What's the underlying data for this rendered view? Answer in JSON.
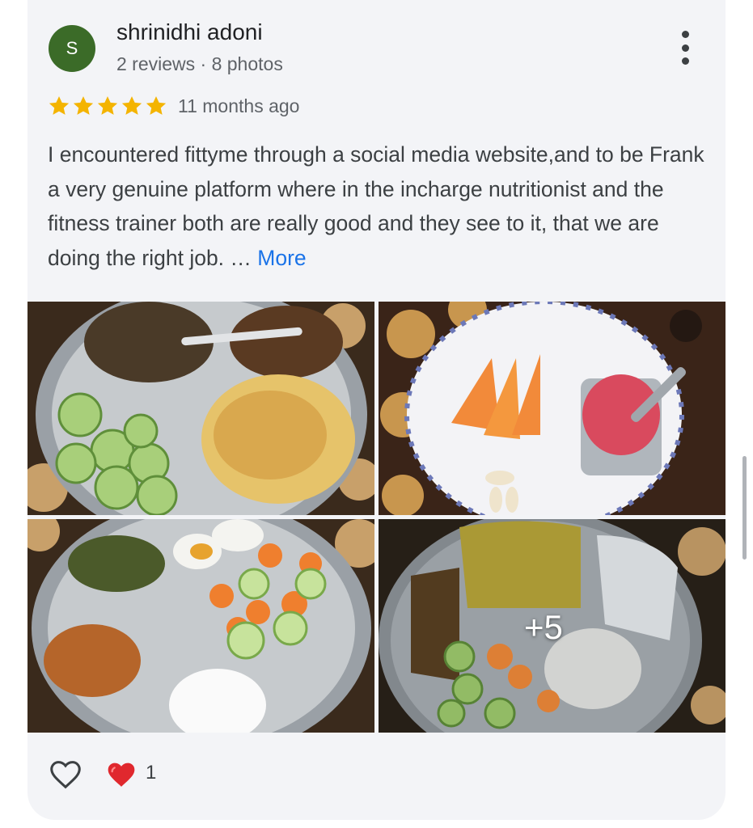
{
  "review": {
    "avatar_letter": "S",
    "author_name": "shrinidhi adoni",
    "author_meta": "2 reviews · 8 photos",
    "rating": 5,
    "rating_max": 5,
    "time_ago": "11 months ago",
    "text": "I encountered fittyme through a social media website,and to be Frank a very genuine platform where in the incharge nutritionist and the fitness trainer both are really good and they see to it, that we are doing the right job. … ",
    "more_label": "More",
    "extra_photos_label": "+5",
    "reaction_count": "1"
  },
  "icons": {
    "menu": "more-vert-icon",
    "star": "star-icon",
    "like": "heart-outline-icon",
    "reaction": "red-heart-icon"
  },
  "colors": {
    "avatar_bg": "#3b6b28",
    "star": "#f4b400",
    "link": "#1a73e8",
    "card_bg": "#f3f4f7"
  }
}
